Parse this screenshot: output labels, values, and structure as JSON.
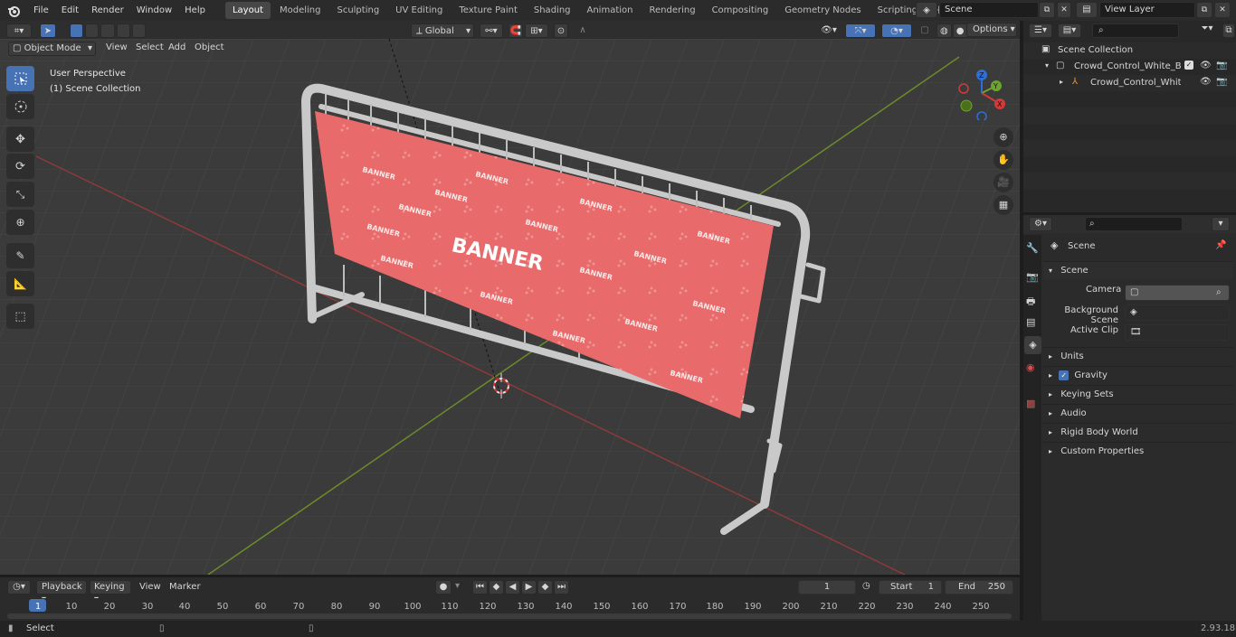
{
  "topbar": {
    "menus": [
      "File",
      "Edit",
      "Render",
      "Window",
      "Help"
    ],
    "workspace_tabs": [
      {
        "label": "Layout",
        "active": true
      },
      {
        "label": "Modeling"
      },
      {
        "label": "Sculpting"
      },
      {
        "label": "UV Editing"
      },
      {
        "label": "Texture Paint"
      },
      {
        "label": "Shading"
      },
      {
        "label": "Animation"
      },
      {
        "label": "Rendering"
      },
      {
        "label": "Compositing"
      },
      {
        "label": "Geometry Nodes"
      },
      {
        "label": "Scripting"
      }
    ],
    "scene_name": "Scene",
    "view_layer": "View Layer"
  },
  "viewport_header": {
    "mode": "Object Mode",
    "menus": [
      "View",
      "Select",
      "Add",
      "Object"
    ],
    "transform_orientation": "Global",
    "options_label": "Options"
  },
  "viewport": {
    "perspective_label": "User Perspective",
    "collection_label": "(1) Scene Collection",
    "banner_text": "BANNER",
    "accent_color": "#e86a6a"
  },
  "outliner": {
    "root": "Scene Collection",
    "items": [
      {
        "label": "Crowd_Control_White_Barrica",
        "level": 1
      },
      {
        "label": "Crowd_Control_White_Ba",
        "level": 2
      }
    ]
  },
  "properties": {
    "context_label": "Scene",
    "section_title": "Scene",
    "fields": [
      {
        "label": "Camera",
        "value": ""
      },
      {
        "label": "Background Scene",
        "value": ""
      },
      {
        "label": "Active Clip",
        "value": ""
      }
    ],
    "panels": [
      "Units",
      "Gravity",
      "Keying Sets",
      "Audio",
      "Rigid Body World",
      "Custom Properties"
    ],
    "gravity_checked": true
  },
  "timeline": {
    "menus": [
      "Playback",
      "Keying",
      "View",
      "Marker"
    ],
    "current_frame": "1",
    "start_label": "Start",
    "start_value": "1",
    "end_label": "End",
    "end_value": "250",
    "ticks": [
      "1",
      "10",
      "20",
      "30",
      "40",
      "50",
      "60",
      "70",
      "80",
      "90",
      "100",
      "110",
      "120",
      "130",
      "140",
      "150",
      "160",
      "170",
      "180",
      "190",
      "200",
      "210",
      "220",
      "230",
      "240",
      "250"
    ]
  },
  "statusbar": {
    "left_label": "Select",
    "version": "2.93.18"
  }
}
